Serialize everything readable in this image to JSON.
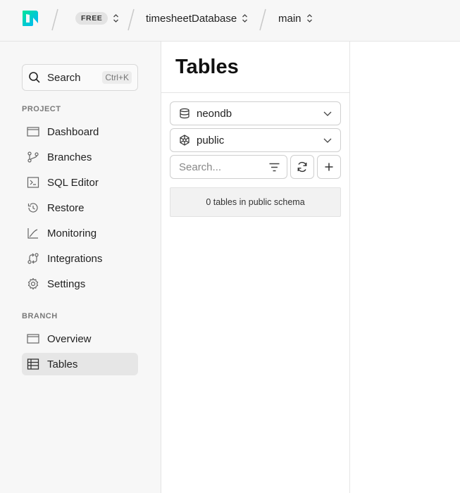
{
  "topbar": {
    "plan_badge": "FREE",
    "project": "timesheetDatabase",
    "branch": "main",
    "brand_color": "#00e699"
  },
  "sidebar": {
    "search": {
      "label": "Search",
      "shortcut": "Ctrl+K"
    },
    "project_section": "PROJECT",
    "project_items": [
      {
        "label": "Dashboard",
        "icon": "dashboard-icon"
      },
      {
        "label": "Branches",
        "icon": "branches-icon"
      },
      {
        "label": "SQL Editor",
        "icon": "sql-editor-icon"
      },
      {
        "label": "Restore",
        "icon": "restore-icon"
      },
      {
        "label": "Monitoring",
        "icon": "monitoring-icon"
      },
      {
        "label": "Integrations",
        "icon": "integrations-icon"
      },
      {
        "label": "Settings",
        "icon": "settings-icon"
      }
    ],
    "branch_section": "BRANCH",
    "branch_items": [
      {
        "label": "Overview",
        "icon": "overview-icon"
      },
      {
        "label": "Tables",
        "icon": "tables-icon",
        "active": true
      }
    ]
  },
  "panel": {
    "title": "Tables",
    "database": "neondb",
    "schema": "public",
    "search_placeholder": "Search...",
    "empty_message": "0 tables in public schema"
  }
}
